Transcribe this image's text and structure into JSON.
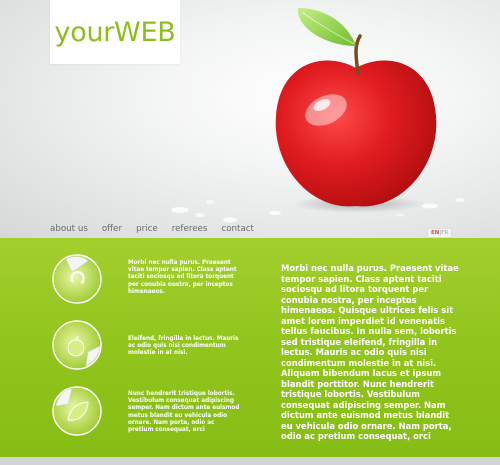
{
  "logo": {
    "text": "yourWEB"
  },
  "nav": {
    "items": [
      "about us",
      "offer",
      "price",
      "referees",
      "contact"
    ]
  },
  "lang": {
    "en": "EN",
    "sep": "|",
    "fr": "FR"
  },
  "features": [
    {
      "icon": "recycle-icon",
      "text": "Morbi nec nulla purus. Praesent vitae tempor sapien. Class aptent taciti sociosqu ad litora torquent per conubia nostra, per inceptos himenaeos."
    },
    {
      "icon": "apple-icon",
      "text": "Eleifend, fringilla in lectus. Mauris ac odio quis nisi condimentum molestie in at nisi."
    },
    {
      "icon": "leaf-icon",
      "text": "Nunc hendrerit tristique lobortis. Vestibulum consequat adipiscing semper. Nam dictum ante euismod metus blandit eu vehicula odio ornare. Nam porta, odio ac pretium consequat, orci"
    }
  ],
  "main_text": "Morbi nec nulla purus. Praesent vitae tempor sapien. Class aptent taciti sociosqu ad litora torquent per conubia nostra, per inceptos himenaeos. Quisque ultrices felis sit amet lorem imperdiet id venenatis tellus faucibus. In nulla sem, lobortis sed tristique eleifend, fringilla in lectus. Mauris ac odio quis nisi condimentum molestie in at nisi. Aliquam bibendum lacus et ipsum blandit porttitor. Nunc hendrerit tristique lobortis. Vestibulum consequat adipiscing semper. Nam dictum ante euismod metus blandit eu vehicula odio ornare. Nam porta, odio ac pretium consequat, orci",
  "colors": {
    "brand_green": "#8cbf1d",
    "band_green": "#93c51f",
    "apple_red": "#d4141b"
  }
}
